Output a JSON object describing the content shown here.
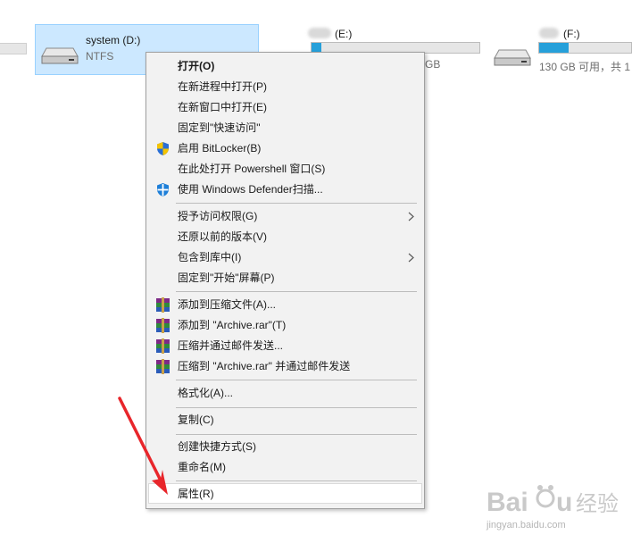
{
  "drives": [
    {
      "name": "system (D:)",
      "filesystem": "NTFS",
      "selected": true
    },
    {
      "name": "(E:)",
      "free_partial": "GB",
      "usage_fraction": 0.06
    },
    {
      "name": "(F:)",
      "capacity": "130 GB 可用，共 1",
      "usage_fraction": 0.32
    }
  ],
  "context_menu": {
    "items": [
      {
        "label": "打开(O)",
        "bold": true,
        "icon": null,
        "submenu": false
      },
      {
        "label": "在新进程中打开(P)",
        "icon": null,
        "submenu": false
      },
      {
        "label": "在新窗口中打开(E)",
        "icon": null,
        "submenu": false
      },
      {
        "label": "固定到\"快速访问\"",
        "icon": null,
        "submenu": false
      },
      {
        "label": "启用 BitLocker(B)",
        "icon": "uac-shield-icon",
        "submenu": false
      },
      {
        "label": "在此处打开 Powershell 窗口(S)",
        "icon": null,
        "submenu": false
      },
      {
        "label": "使用 Windows Defender扫描...",
        "icon": "defender-shield-icon",
        "submenu": false
      },
      {
        "label": "授予访问权限(G)",
        "icon": null,
        "submenu": true
      },
      {
        "label": "还原以前的版本(V)",
        "icon": null,
        "submenu": false
      },
      {
        "label": "包含到库中(I)",
        "icon": null,
        "submenu": true
      },
      {
        "label": "固定到\"开始\"屏幕(P)",
        "icon": null,
        "submenu": false
      },
      {
        "label": "添加到压缩文件(A)...",
        "icon": "winrar-icon",
        "submenu": false
      },
      {
        "label": "添加到 \"Archive.rar\"(T)",
        "icon": "winrar-icon",
        "submenu": false
      },
      {
        "label": "压缩并通过邮件发送...",
        "icon": "winrar-icon",
        "submenu": false
      },
      {
        "label": "压缩到 \"Archive.rar\" 并通过邮件发送",
        "icon": "winrar-icon",
        "submenu": false
      },
      {
        "label": "格式化(A)...",
        "icon": null,
        "submenu": false
      },
      {
        "label": "复制(C)",
        "icon": null,
        "submenu": false
      },
      {
        "label": "创建快捷方式(S)",
        "icon": null,
        "submenu": false
      },
      {
        "label": "重命名(M)",
        "icon": null,
        "submenu": false
      },
      {
        "label": "属性(R)",
        "icon": null,
        "submenu": false,
        "highlighted": true
      }
    ]
  },
  "colors": {
    "selection_bg": "#cce8ff",
    "menu_bg": "#f2f2f2",
    "usage_fill": "#26a0da",
    "annotation_arrow": "#e8262b"
  },
  "watermark": {
    "logo": "Baidu 经验",
    "url": "jingyan.baidu.com"
  }
}
